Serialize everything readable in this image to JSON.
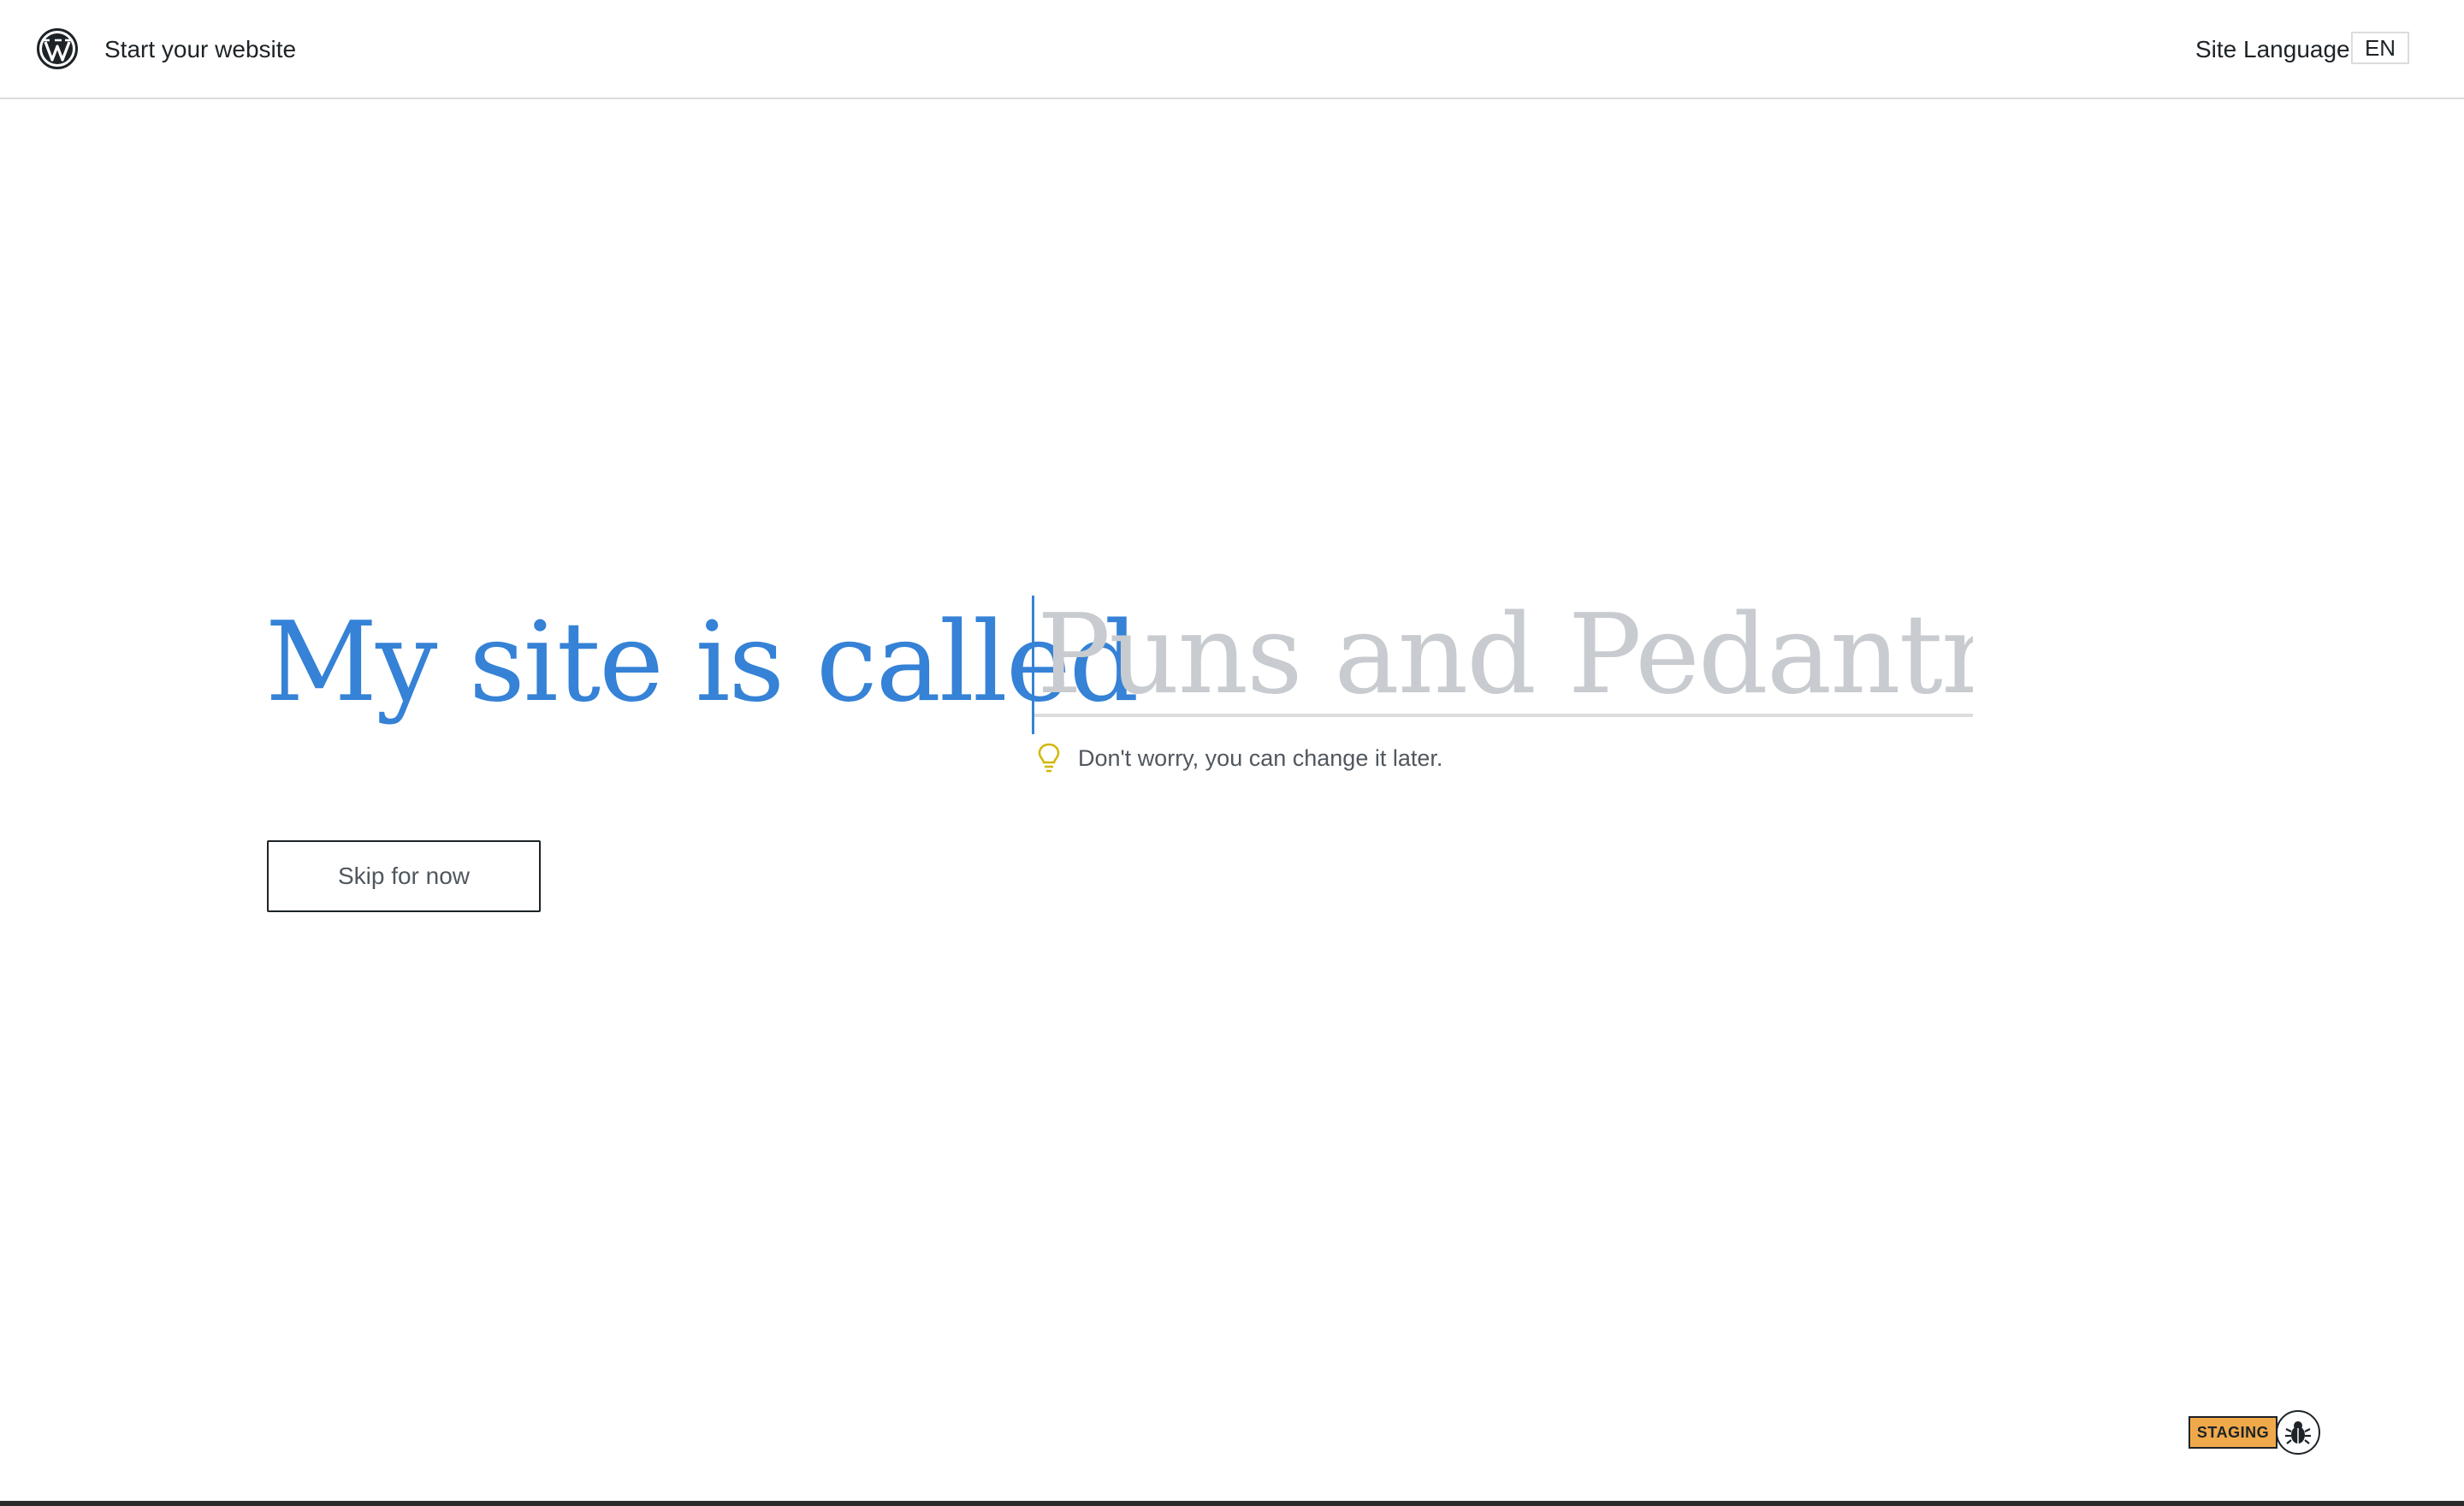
{
  "header": {
    "title": "Start your website",
    "language_label": "Site Language",
    "language_value": "EN"
  },
  "main": {
    "headline": "My site is called",
    "site_name_placeholder": "Puns and Pedantry",
    "site_name_value": "",
    "hint": "Don't worry, you can change it later.",
    "skip_label": "Skip for now"
  },
  "footer": {
    "staging_label": "STAGING"
  },
  "icons": {
    "logo": "wordpress-logo-icon",
    "hint": "lightbulb-icon",
    "debug": "bug-icon"
  },
  "colors": {
    "accent": "#3582d6",
    "placeholder": "#c8cbcf",
    "hint_icon": "#d4b600",
    "staging": "#f0a94a"
  }
}
